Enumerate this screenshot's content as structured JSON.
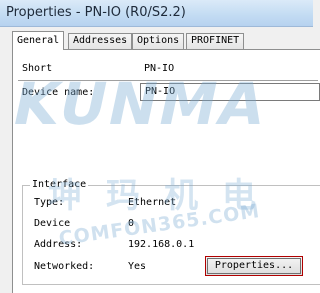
{
  "window": {
    "title": "Properties - PN-IO (R0/S2.2)"
  },
  "tabs": [
    {
      "label": "General",
      "active": true
    },
    {
      "label": "Addresses",
      "active": false
    },
    {
      "label": "Options",
      "active": false
    },
    {
      "label": "PROFINET",
      "active": false
    }
  ],
  "general": {
    "short_label": "Short",
    "short_value": "PN-IO",
    "device_name_label": "Device name:",
    "device_name_value": "PN-IO"
  },
  "interface": {
    "legend": "Interface",
    "type_label": "Type:",
    "type_value": "Ethernet",
    "device_label": "Device",
    "device_value": "0",
    "address_label": "Address:",
    "address_value": "192.168.0.1",
    "networked_label": "Networked:",
    "networked_value": "Yes",
    "properties_button": "Properties..."
  },
  "watermark": {
    "brand": "KUNMA",
    "chinese": "坤玛机电",
    "url": "COMFON365.COM"
  },
  "colors": {
    "titlebar": "#c4dcf3",
    "button_highlight": "#b00000",
    "watermark": "#78aad2"
  }
}
